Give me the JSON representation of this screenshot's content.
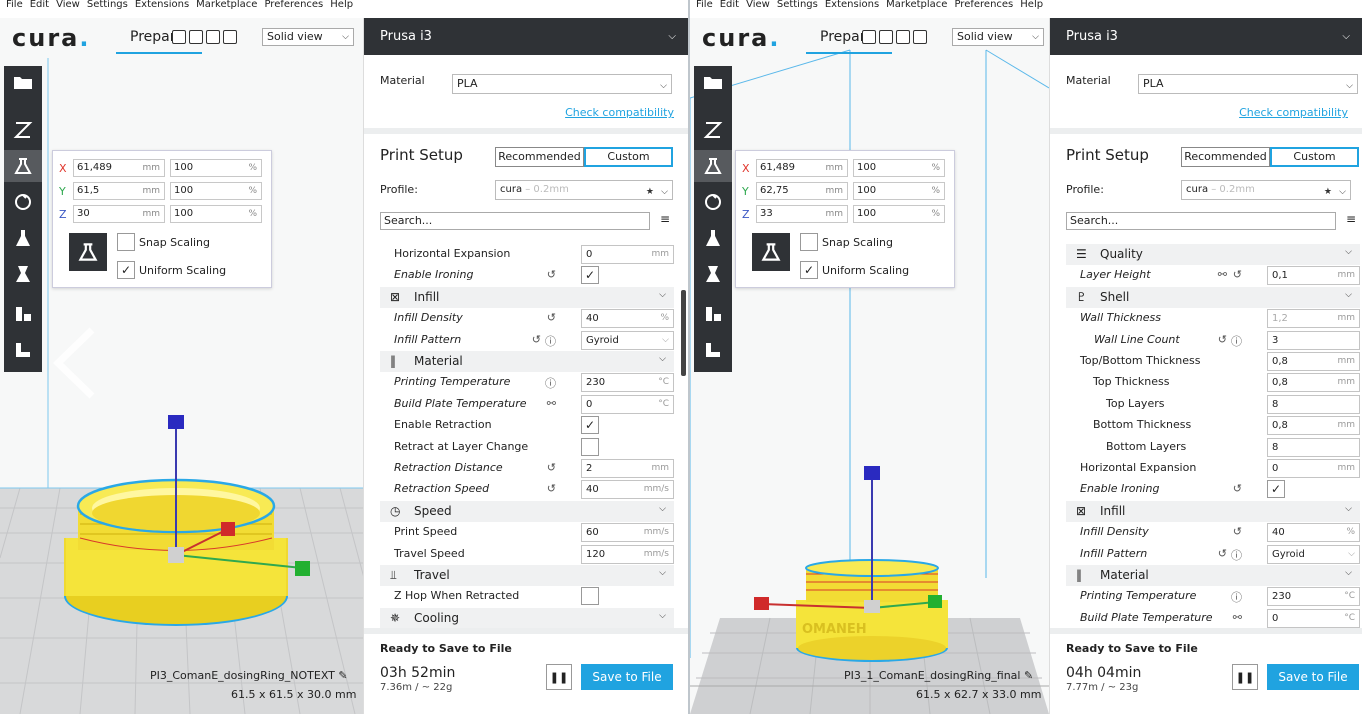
{
  "colors": {
    "accent": "#20a3e0",
    "toolbar": "#2f3236",
    "model": "#f5e43a",
    "outline": "#2aa8e6"
  },
  "left": {
    "menu": [
      "File",
      "Edit",
      "View",
      "Settings",
      "Extensions",
      "Marketplace",
      "Preferences",
      "Help"
    ],
    "logo": "cura",
    "logo_dot": ".",
    "stage": "Prepare",
    "view_select": "Solid view",
    "printer": "Prusa i3",
    "material_label": "Material",
    "material": "PLA",
    "check_compat": "Check compatibility",
    "print_setup": "Print Setup",
    "mode_recommended": "Recommended",
    "mode_custom": "Custom",
    "profile_label": "Profile:",
    "profile_name": "cura",
    "profile_ghost": " – 0.2mm",
    "search_placeholder": "Search...",
    "scale": {
      "x_mm": "61,489",
      "y_mm": "61,5",
      "z_mm": "30",
      "x_pct": "100",
      "y_pct": "100",
      "z_pct": "100",
      "mm": "mm",
      "pct": "%",
      "snap": "Snap Scaling",
      "uniform": "Uniform Scaling"
    },
    "settings": [
      {
        "type": "row",
        "label": "Horizontal Expansion",
        "value": "0",
        "unit": "mm",
        "italic": false,
        "indent": 14
      },
      {
        "type": "cbrow",
        "label": "Enable Ironing",
        "checked": true,
        "italic": true,
        "indent": 14,
        "icons": "reset"
      },
      {
        "type": "cat",
        "label": "Infill",
        "icon": "infill-icon"
      },
      {
        "type": "row",
        "label": "Infill Density",
        "value": "40",
        "unit": "%",
        "italic": true,
        "indent": 14,
        "icons": "reset"
      },
      {
        "type": "sel",
        "label": "Infill Pattern",
        "value": "Gyroid",
        "italic": true,
        "indent": 14,
        "icons": "reset-info"
      },
      {
        "type": "cat",
        "label": "Material",
        "icon": "material-icon"
      },
      {
        "type": "row",
        "label": "Printing Temperature",
        "value": "230",
        "unit": "°C",
        "italic": true,
        "indent": 14,
        "icons": "info"
      },
      {
        "type": "row",
        "label": "Build Plate Temperature",
        "value": "0",
        "unit": "°C",
        "italic": true,
        "indent": 14,
        "icons": "link"
      },
      {
        "type": "cbrow",
        "label": "Enable Retraction",
        "checked": true,
        "italic": false,
        "indent": 14
      },
      {
        "type": "cbrow",
        "label": "Retract at Layer Change",
        "checked": false,
        "italic": false,
        "indent": 14
      },
      {
        "type": "row",
        "label": "Retraction Distance",
        "value": "2",
        "unit": "mm",
        "italic": true,
        "indent": 14,
        "icons": "reset"
      },
      {
        "type": "row",
        "label": "Retraction Speed",
        "value": "40",
        "unit": "mm/s",
        "italic": true,
        "indent": 14,
        "icons": "reset"
      },
      {
        "type": "cat",
        "label": "Speed",
        "icon": "speed-icon"
      },
      {
        "type": "row",
        "label": "Print Speed",
        "value": "60",
        "unit": "mm/s",
        "italic": false,
        "indent": 14
      },
      {
        "type": "row",
        "label": "Travel Speed",
        "value": "120",
        "unit": "mm/s",
        "italic": false,
        "indent": 14
      },
      {
        "type": "cat",
        "label": "Travel",
        "icon": "travel-icon"
      },
      {
        "type": "cbrow",
        "label": "Z Hop When Retracted",
        "checked": false,
        "italic": false,
        "indent": 14
      },
      {
        "type": "cat",
        "label": "Cooling",
        "icon": "cooling-icon"
      }
    ],
    "ready": "Ready to Save to File",
    "time": "03h 52min",
    "length": "7.36m / ~ 22g",
    "save": "Save to File",
    "filename": "PI3_ComanE_dosingRing_NOTEXT",
    "dims": "61.5 x 61.5 x 30.0 mm"
  },
  "right": {
    "menu": [
      "File",
      "Edit",
      "View",
      "Settings",
      "Extensions",
      "Marketplace",
      "Preferences",
      "Help"
    ],
    "logo": "cura",
    "logo_dot": ".",
    "stage": "Prepare",
    "view_select": "Solid view",
    "printer": "Prusa i3",
    "material_label": "Material",
    "material": "PLA",
    "check_compat": "Check compatibility",
    "print_setup": "Print Setup",
    "mode_recommended": "Recommended",
    "mode_custom": "Custom",
    "profile_label": "Profile:",
    "profile_name": "cura",
    "profile_ghost": " – 0.2mm",
    "search_placeholder": "Search...",
    "scale": {
      "x_mm": "61,489",
      "y_mm": "62,75",
      "z_mm": "33",
      "x_pct": "100",
      "y_pct": "100",
      "z_pct": "100",
      "mm": "mm",
      "pct": "%",
      "snap": "Snap Scaling",
      "uniform": "Uniform Scaling"
    },
    "settings": [
      {
        "type": "cat",
        "label": "Quality",
        "icon": "quality-icon"
      },
      {
        "type": "row",
        "label": "Layer Height",
        "value": "0,1",
        "unit": "mm",
        "italic": true,
        "indent": 14,
        "icons": "link-reset"
      },
      {
        "type": "cat",
        "label": "Shell",
        "icon": "shell-icon"
      },
      {
        "type": "row",
        "label": "Wall Thickness",
        "value": "1,2",
        "unit": "mm",
        "italic": true,
        "indent": 14,
        "disabled": true
      },
      {
        "type": "row",
        "label": "Wall Line Count",
        "value": "3",
        "unit": "",
        "italic": true,
        "indent": 28,
        "icons": "reset-info"
      },
      {
        "type": "row",
        "label": "Top/Bottom Thickness",
        "value": "0,8",
        "unit": "mm",
        "italic": false,
        "indent": 14
      },
      {
        "type": "row",
        "label": "Top Thickness",
        "value": "0,8",
        "unit": "mm",
        "italic": false,
        "indent": 27
      },
      {
        "type": "row",
        "label": "Top Layers",
        "value": "8",
        "unit": "",
        "italic": false,
        "indent": 40
      },
      {
        "type": "row",
        "label": "Bottom Thickness",
        "value": "0,8",
        "unit": "mm",
        "italic": false,
        "indent": 27
      },
      {
        "type": "row",
        "label": "Bottom Layers",
        "value": "8",
        "unit": "",
        "italic": false,
        "indent": 40
      },
      {
        "type": "row",
        "label": "Horizontal Expansion",
        "value": "0",
        "unit": "mm",
        "italic": false,
        "indent": 14
      },
      {
        "type": "cbrow",
        "label": "Enable Ironing",
        "checked": true,
        "italic": true,
        "indent": 14,
        "icons": "reset"
      },
      {
        "type": "cat",
        "label": "Infill",
        "icon": "infill-icon"
      },
      {
        "type": "row",
        "label": "Infill Density",
        "value": "40",
        "unit": "%",
        "italic": true,
        "indent": 14,
        "icons": "reset"
      },
      {
        "type": "sel",
        "label": "Infill Pattern",
        "value": "Gyroid",
        "italic": true,
        "indent": 14,
        "icons": "reset-info"
      },
      {
        "type": "cat",
        "label": "Material",
        "icon": "material-icon"
      },
      {
        "type": "row",
        "label": "Printing Temperature",
        "value": "230",
        "unit": "°C",
        "italic": true,
        "indent": 14,
        "icons": "info"
      },
      {
        "type": "row",
        "label": "Build Plate Temperature",
        "value": "0",
        "unit": "°C",
        "italic": true,
        "indent": 14,
        "icons": "link"
      }
    ],
    "ready": "Ready to Save to File",
    "time": "04h 04min",
    "length": "7.77m / ~ 23g",
    "save": "Save to File",
    "filename": "PI3_1_ComanE_dosingRing_final",
    "dims": "61.5 x 62.7 x 33.0 mm",
    "model_text": "OMANEH"
  }
}
